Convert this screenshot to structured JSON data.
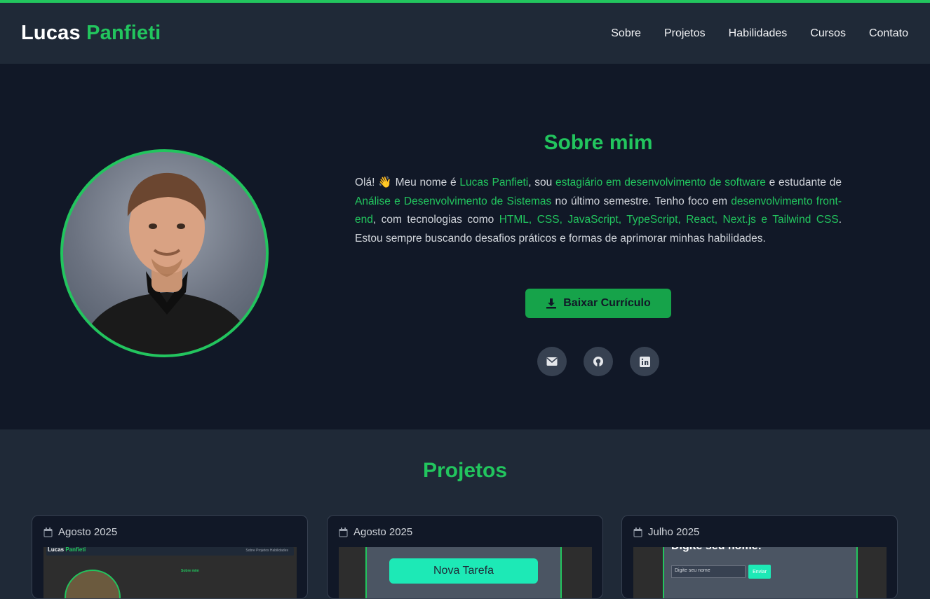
{
  "header": {
    "brand_first": "Lucas",
    "brand_last": "Panfieti",
    "nav": [
      "Sobre",
      "Projetos",
      "Habilidades",
      "Cursos",
      "Contato"
    ]
  },
  "about": {
    "title": "Sobre mim",
    "paragraph": [
      {
        "text": "Olá! 👋 Meu nome é ",
        "hl": false
      },
      {
        "text": "Lucas Panfieti",
        "hl": true
      },
      {
        "text": ", sou ",
        "hl": false
      },
      {
        "text": "estagiário em desenvolvimento de software",
        "hl": true
      },
      {
        "text": " e estudante de ",
        "hl": false
      },
      {
        "text": "Análise e Desenvolvimento de Sistemas",
        "hl": true
      },
      {
        "text": " no último semestre. Tenho foco em ",
        "hl": false
      },
      {
        "text": "desenvolvimento front-end",
        "hl": true
      },
      {
        "text": ", com tecnologias como ",
        "hl": false
      },
      {
        "text": "HTML, CSS, JavaScript, TypeScript, React, Next.js e Tailwind CSS",
        "hl": true
      },
      {
        "text": ". Estou sempre buscando desafios práticos e formas de aprimorar minhas habilidades.",
        "hl": false
      }
    ],
    "cv_button": "Baixar Currículo",
    "socials": [
      "envelope-icon",
      "github-icon",
      "linkedin-icon"
    ]
  },
  "projects": {
    "title": "Projetos",
    "cards": [
      {
        "date": "Agosto 2025",
        "thumb": {
          "brand_first": "Lucas",
          "brand_last": "Panfieti",
          "nav": "Sobre  Projetos  Habilidades",
          "heading": "Sobre mim"
        }
      },
      {
        "date": "Agosto 2025",
        "thumb": {
          "button": "Nova Tarefa"
        }
      },
      {
        "date": "Julho 2025",
        "thumb": {
          "heading": "Digite seu nome:",
          "placeholder": "Digite seu nome",
          "button": "Enviar"
        }
      }
    ]
  },
  "colors": {
    "accent": "#22c55e",
    "bg_dark": "#111827",
    "bg_mid": "#1f2937"
  }
}
